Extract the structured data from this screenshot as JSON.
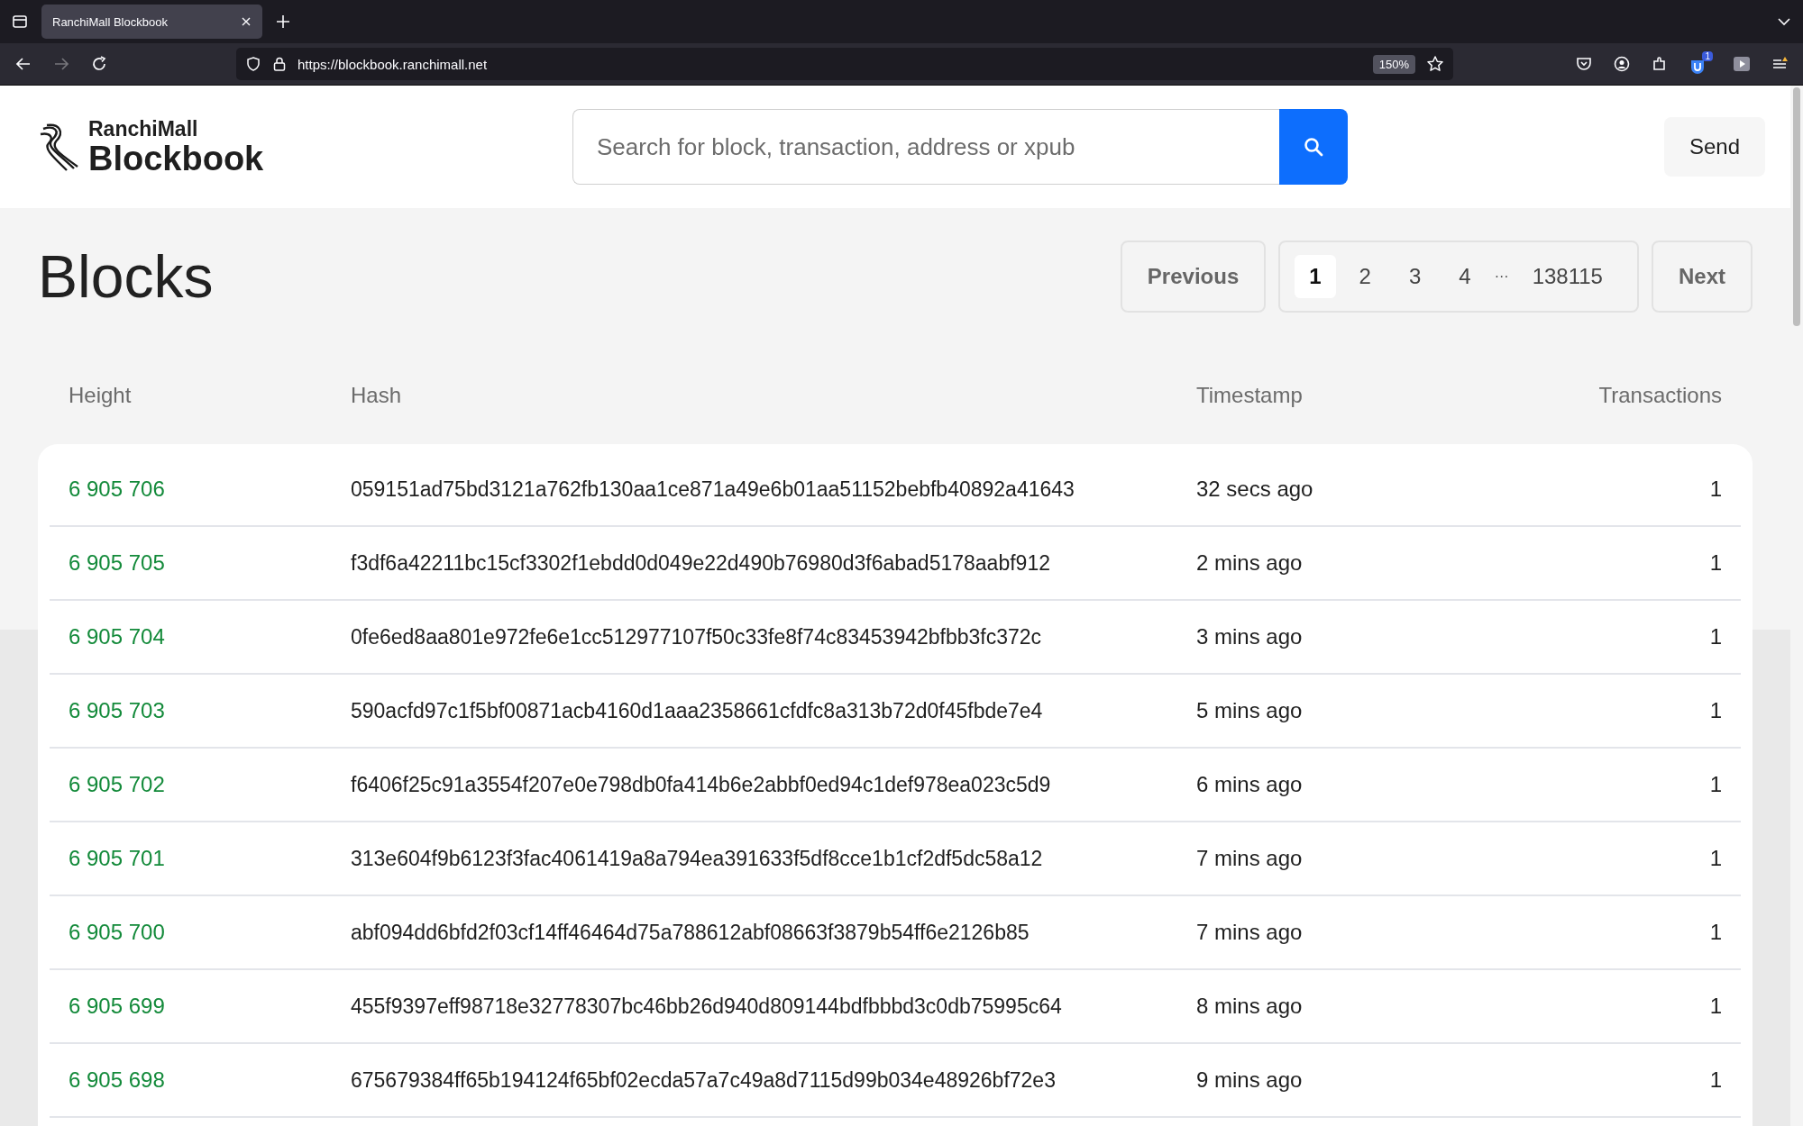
{
  "browser": {
    "tabs": [
      {
        "title": "RanchiMall Blockbook",
        "selected": true
      }
    ],
    "url": "https://blockbook.ranchimall.net",
    "zoom": "150%",
    "extension_badge": "1"
  },
  "header": {
    "logo_top": "RanchiMall",
    "logo_bottom": "Blockbook",
    "search": {
      "placeholder": "Search for block, transaction, address or xpub"
    },
    "send_button": "Send"
  },
  "page_title": "Blocks",
  "pagination": {
    "previous": "Previous",
    "next": "Next",
    "pages": [
      {
        "kind": "page",
        "label": "1",
        "selected": true
      },
      {
        "kind": "page",
        "label": "2",
        "selected": false
      },
      {
        "kind": "page",
        "label": "3",
        "selected": false
      },
      {
        "kind": "page",
        "label": "4",
        "selected": false
      },
      {
        "kind": "ellipsis",
        "label": "···"
      },
      {
        "kind": "page",
        "label": "138115",
        "selected": false
      }
    ]
  },
  "table": {
    "columns": [
      "Height",
      "Hash",
      "Timestamp",
      "Transactions"
    ],
    "rows": [
      {
        "height": "6 905 706",
        "hash": "059151ad75bd3121a762fb130aa1ce871a49e6b01aa51152bebfb40892a41643",
        "timestamp": "32 secs ago",
        "transactions": "1"
      },
      {
        "height": "6 905 705",
        "hash": "f3df6a42211bc15cf3302f1ebdd0d049e22d490b76980d3f6abad5178aabf912",
        "timestamp": "2 mins ago",
        "transactions": "1"
      },
      {
        "height": "6 905 704",
        "hash": "0fe6ed8aa801e972fe6e1cc512977107f50c33fe8f74c83453942bfbb3fc372c",
        "timestamp": "3 mins ago",
        "transactions": "1"
      },
      {
        "height": "6 905 703",
        "hash": "590acfd97c1f5bf00871acb4160d1aaa2358661cfdfc8a313b72d0f45fbde7e4",
        "timestamp": "5 mins ago",
        "transactions": "1"
      },
      {
        "height": "6 905 702",
        "hash": "f6406f25c91a3554f207e0e798db0fa414b6e2abbf0ed94c1def978ea023c5d9",
        "timestamp": "6 mins ago",
        "transactions": "1"
      },
      {
        "height": "6 905 701",
        "hash": "313e604f9b6123f3fac4061419a8a794ea391633f5df8cce1b1cf2df5dc58a12",
        "timestamp": "7 mins ago",
        "transactions": "1"
      },
      {
        "height": "6 905 700",
        "hash": "abf094dd6bfd2f03cf14ff46464d75a788612abf08663f3879b54ff6e2126b85",
        "timestamp": "7 mins ago",
        "transactions": "1"
      },
      {
        "height": "6 905 699",
        "hash": "455f9397eff98718e32778307bc46bb26d940d809144bdfbbbd3c0db75995c64",
        "timestamp": "8 mins ago",
        "transactions": "1"
      },
      {
        "height": "6 905 698",
        "hash": "675679384ff65b194124f65bf02ecda57a7c49a8d7115d99b034e48926bf72e3",
        "timestamp": "9 mins ago",
        "transactions": "1"
      }
    ]
  }
}
